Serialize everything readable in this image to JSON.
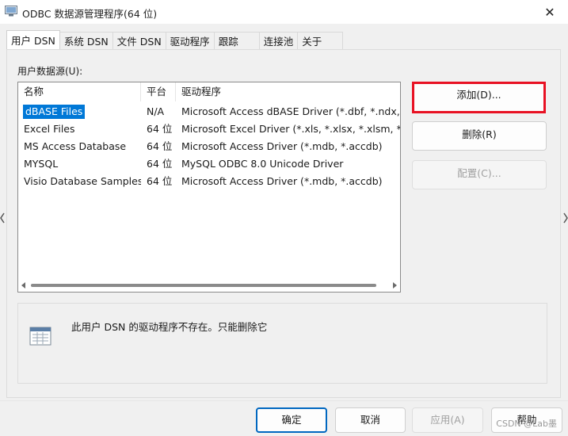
{
  "window": {
    "title": "ODBC 数据源管理程序(64 位)",
    "close_glyph": "✕"
  },
  "tabs": [
    {
      "label": "用户 DSN"
    },
    {
      "label": "系统 DSN"
    },
    {
      "label": "文件 DSN"
    },
    {
      "label": "驱动程序"
    },
    {
      "label": "跟踪"
    },
    {
      "label": "连接池"
    },
    {
      "label": "关于"
    }
  ],
  "user_dsn": {
    "group_label": "用户数据源(U):",
    "columns": [
      "名称",
      "平台",
      "驱动程序"
    ],
    "rows": [
      {
        "name": "dBASE Files",
        "platform": "N/A",
        "driver": "Microsoft Access dBASE Driver (*.dbf, *.ndx, *"
      },
      {
        "name": "Excel Files",
        "platform": "64 位",
        "driver": "Microsoft Excel Driver (*.xls, *.xlsx, *.xlsm, *.xls"
      },
      {
        "name": "MS Access Database",
        "platform": "64 位",
        "driver": "Microsoft Access Driver (*.mdb, *.accdb)"
      },
      {
        "name": "MYSQL",
        "platform": "64 位",
        "driver": "MySQL ODBC 8.0 Unicode Driver"
      },
      {
        "name": "Visio Database Samples",
        "platform": "64 位",
        "driver": "Microsoft Access Driver (*.mdb, *.accdb)"
      }
    ],
    "selected_index": 0,
    "buttons": {
      "add": "添加(D)...",
      "remove": "删除(R)",
      "configure": "配置(C)..."
    },
    "info_text": "此用户 DSN 的驱动程序不存在。只能删除它"
  },
  "footer": {
    "ok": "确定",
    "cancel": "取消",
    "apply": "应用(A)",
    "help": "帮助"
  },
  "watermark": "CSDN @Lab墨",
  "colors": {
    "selection": "#0078d7",
    "highlight_border": "#e81123",
    "primary_border": "#0067c0"
  }
}
